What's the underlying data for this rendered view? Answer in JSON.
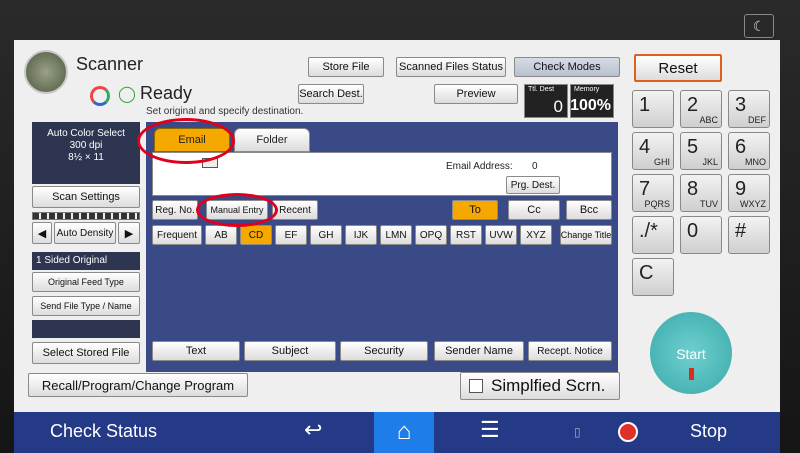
{
  "header": {
    "app_title": "Scanner",
    "ready": "Ready",
    "instruction": "Set original and specify destination.",
    "store_file": "Store File",
    "scanned_status": "Scanned Files Status",
    "check_modes": "Check Modes",
    "search_dest": "Search Dest.",
    "preview": "Preview",
    "ttl_dest_label": "Ttl. Dest",
    "ttl_dest": "0",
    "memory_label": "Memory",
    "memory": "100%",
    "reset": "Reset"
  },
  "left": {
    "color_mode": "Auto Color Select",
    "dpi": "300 dpi",
    "paper": "8½ × 11",
    "scan_settings": "Scan Settings",
    "density": "Auto Density",
    "sided": "1 Sided Original",
    "feed": "Original Feed Type",
    "send_type": "Send File Type / Name",
    "stored": "Select Stored File"
  },
  "tabs": [
    {
      "label": "Email"
    },
    {
      "label": "Folder"
    }
  ],
  "dest": {
    "email_address_label": "Email Address:",
    "email_count": "0",
    "prg_dest": "Prg. Dest.",
    "reg_no": "Reg. No.",
    "manual_entry": "Manual Entry",
    "recent": "Recent",
    "to": "To",
    "cc": "Cc",
    "bcc": "Bcc"
  },
  "index_tabs": [
    "Frequent",
    "AB",
    "CD",
    "EF",
    "GH",
    "IJK",
    "LMN",
    "OPQ",
    "RST",
    "UVW",
    "XYZ"
  ],
  "change_title": "Change Title",
  "bottom_opts": [
    "Text",
    "Subject",
    "Security",
    "Sender Name",
    "Recept. Notice"
  ],
  "recall": "Recall/Program/Change Program",
  "simplified": "Simplfied Scrn.",
  "keypad": [
    {
      "d": "1",
      "l": ""
    },
    {
      "d": "2",
      "l": "ABC"
    },
    {
      "d": "3",
      "l": "DEF"
    },
    {
      "d": "4",
      "l": "GHI"
    },
    {
      "d": "5",
      "l": "JKL"
    },
    {
      "d": "6",
      "l": "MNO"
    },
    {
      "d": "7",
      "l": "PQRS"
    },
    {
      "d": "8",
      "l": "TUV"
    },
    {
      "d": "9",
      "l": "WXYZ"
    },
    {
      "d": "./*",
      "l": ""
    },
    {
      "d": "0",
      "l": ""
    },
    {
      "d": "#",
      "l": ""
    }
  ],
  "clear": "C",
  "start": "Start",
  "nav": {
    "check_status": "Check Status",
    "stop": "Stop"
  },
  "colors": {
    "accent": "#f5a800",
    "nav": "#253a86",
    "start": "#4fb8b8",
    "highlight": "#e0001b"
  }
}
